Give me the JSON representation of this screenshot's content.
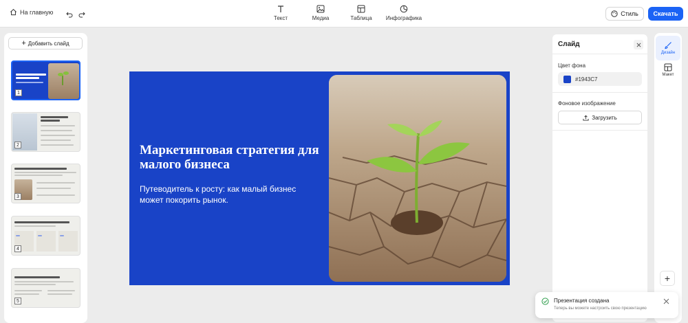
{
  "header": {
    "home_label": "На главную",
    "tools": [
      {
        "label": "Текст",
        "icon": "text-icon"
      },
      {
        "label": "Медиа",
        "icon": "image-icon"
      },
      {
        "label": "Таблица",
        "icon": "table-icon"
      },
      {
        "label": "Инфографика",
        "icon": "chart-icon"
      }
    ],
    "style_label": "Стиль",
    "download_label": "Скачать"
  },
  "sidebar": {
    "add_slide_label": "Добавить слайд",
    "thumbnails": [
      {
        "number": "1",
        "active": true
      },
      {
        "number": "2",
        "active": false
      },
      {
        "number": "3",
        "active": false
      },
      {
        "number": "4",
        "active": false
      },
      {
        "number": "5",
        "active": false
      }
    ]
  },
  "slide": {
    "title": "Маркетинговая стратегия для малого бизнеса",
    "subtitle": "Путеводитель к росту: как малый бизнес может покорить рынок.",
    "background_color": "#1943C7"
  },
  "panel": {
    "title": "Слайд",
    "bg_color_label": "Цвет фона",
    "bg_color_value": "#1943C7",
    "bg_image_label": "Фоновое изображение",
    "upload_label": "Загрузить"
  },
  "rail": {
    "tabs": [
      {
        "label": "Дизайн",
        "icon": "brush-icon",
        "active": true
      },
      {
        "label": "Макет",
        "icon": "layout-icon",
        "active": false
      }
    ]
  },
  "toast": {
    "title": "Презентация создана",
    "text": "Теперь вы можете настроить свою презентацию"
  },
  "colors": {
    "accent": "#1b63f5",
    "slide_bg": "#1943c7",
    "success": "#2e9d4b"
  }
}
